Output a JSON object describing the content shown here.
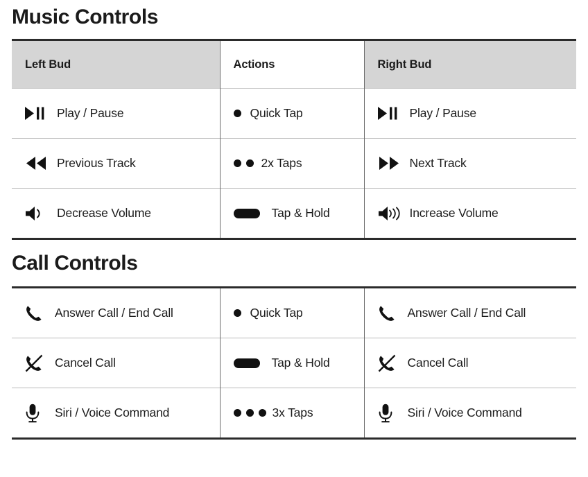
{
  "sections": [
    {
      "title": "Music Controls",
      "has_header": true,
      "headers": [
        "Left Bud",
        "Actions",
        "Right Bud"
      ],
      "header_shading": [
        "shaded",
        "plain",
        "shaded"
      ],
      "rows": [
        {
          "left": {
            "icon": "play-pause-icon",
            "label": "Play / Pause"
          },
          "action": {
            "icon": "one-dot-icon",
            "label": "Quick Tap"
          },
          "right": {
            "icon": "play-pause-icon",
            "label": "Play / Pause"
          }
        },
        {
          "left": {
            "icon": "previous-track-icon",
            "label": "Previous Track"
          },
          "action": {
            "icon": "two-dots-icon",
            "label": "2x Taps"
          },
          "right": {
            "icon": "next-track-icon",
            "label": "Next Track"
          }
        },
        {
          "left": {
            "icon": "volume-down-icon",
            "label": "Decrease Volume"
          },
          "action": {
            "icon": "pill-hold-icon",
            "label": "Tap & Hold"
          },
          "right": {
            "icon": "volume-up-icon",
            "label": "Increase Volume"
          }
        }
      ]
    },
    {
      "title": "Call Controls",
      "has_header": false,
      "headers": [],
      "header_shading": [],
      "rows": [
        {
          "left": {
            "icon": "phone-icon",
            "label": "Answer Call / End Call"
          },
          "action": {
            "icon": "one-dot-icon",
            "label": "Quick Tap"
          },
          "right": {
            "icon": "phone-icon",
            "label": "Answer Call / End Call"
          }
        },
        {
          "left": {
            "icon": "phone-slash-icon",
            "label": "Cancel Call"
          },
          "action": {
            "icon": "pill-hold-icon",
            "label": "Tap & Hold"
          },
          "right": {
            "icon": "phone-slash-icon",
            "label": "Cancel Call"
          }
        },
        {
          "left": {
            "icon": "microphone-icon",
            "label": "Siri / Voice Command"
          },
          "action": {
            "icon": "three-dots-icon",
            "label": "3x Taps"
          },
          "right": {
            "icon": "microphone-icon",
            "label": "Siri / Voice Command"
          }
        }
      ]
    }
  ],
  "colors": {
    "header_shade": "#d5d5d5",
    "rule_strong": "#2b2b2b",
    "rule_light": "#b9b9b9",
    "column_divider": "#6a6a6a",
    "text": "#1b1b1b",
    "icon": "#111111",
    "background": "#ffffff"
  }
}
